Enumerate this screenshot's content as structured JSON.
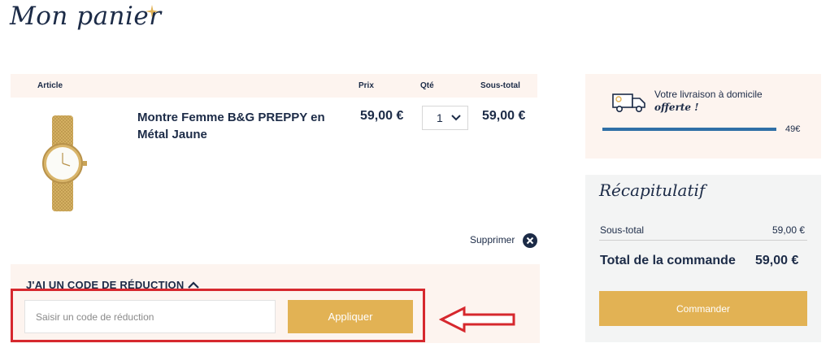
{
  "page": {
    "title": "Mon panier"
  },
  "cart": {
    "headers": {
      "article": "Article",
      "price": "Prix",
      "qty": "Qté",
      "subtotal": "Sous-total"
    },
    "item": {
      "name": "Montre Femme B&G PREPPY en Métal Jaune",
      "price": "59,00 €",
      "quantity": "1",
      "subtotal": "59,00 €"
    },
    "remove_label": "Supprimer"
  },
  "promo": {
    "title": "J'AI UN CODE DE RÉDUCTION",
    "placeholder": "Saisir un code de réduction",
    "apply_label": "Appliquer"
  },
  "delivery": {
    "text": "Votre livraison à domicile",
    "free": "offerte !",
    "threshold": "49€",
    "progress_percent": 100
  },
  "summary": {
    "title": "Récapitulatif",
    "subtotal_label": "Sous-total",
    "subtotal_value": "59,00 €",
    "total_label": "Total de la commande",
    "total_value": "59,00 €",
    "order_label": "Commander"
  },
  "colors": {
    "navy": "#1c2b47",
    "gold": "#e2b254",
    "peach": "#fdf4ef",
    "highlight_red": "#d6282e",
    "progress_blue": "#2f6fa6"
  },
  "icons": [
    "star-icon",
    "chevron-down-icon",
    "close-circle-icon",
    "chevron-up-icon",
    "delivery-truck-icon",
    "red-arrow-icon"
  ]
}
